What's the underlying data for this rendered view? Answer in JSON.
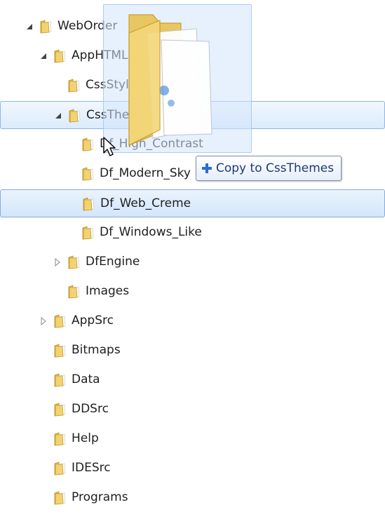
{
  "tree": {
    "items": [
      {
        "label": "WebOrder",
        "level": 0,
        "expander": "expanded",
        "state": "normal"
      },
      {
        "label": "AppHTML",
        "level": 1,
        "expander": "expanded",
        "state": "normal"
      },
      {
        "label": "CssStyle",
        "level": 2,
        "expander": "none",
        "state": "normal"
      },
      {
        "label": "CssThemes",
        "level": 2,
        "expander": "expanded",
        "state": "hover"
      },
      {
        "label": "Df_High_Contrast",
        "level": 3,
        "expander": "none",
        "state": "normal"
      },
      {
        "label": "Df_Modern_Sky",
        "level": 3,
        "expander": "none",
        "state": "normal"
      },
      {
        "label": "Df_Web_Creme",
        "level": 3,
        "expander": "none",
        "state": "drop"
      },
      {
        "label": "Df_Windows_Like",
        "level": 3,
        "expander": "none",
        "state": "normal"
      },
      {
        "label": "DfEngine",
        "level": 2,
        "expander": "collapsed",
        "state": "normal"
      },
      {
        "label": "Images",
        "level": 2,
        "expander": "none",
        "state": "normal"
      },
      {
        "label": "AppSrc",
        "level": 1,
        "expander": "collapsed",
        "state": "normal"
      },
      {
        "label": "Bitmaps",
        "level": 1,
        "expander": "none",
        "state": "normal"
      },
      {
        "label": "Data",
        "level": 1,
        "expander": "none",
        "state": "normal"
      },
      {
        "label": "DDSrc",
        "level": 1,
        "expander": "none",
        "state": "normal"
      },
      {
        "label": "Help",
        "level": 1,
        "expander": "none",
        "state": "normal"
      },
      {
        "label": "IDESrc",
        "level": 1,
        "expander": "none",
        "state": "normal"
      },
      {
        "label": "Programs",
        "level": 1,
        "expander": "none",
        "state": "normal"
      }
    ]
  },
  "drag": {
    "ghost_icon": "folder-icon",
    "cursor_icon": "arrow-cursor-icon",
    "tooltip_icon": "plus-icon",
    "tooltip_text": "Copy to CssThemes"
  },
  "colors": {
    "hover_border": "#8fb6e4",
    "drop_border": "#84acdd",
    "folder_fill": "#f0cf6a",
    "tooltip_text": "#1e3a74",
    "plus_color": "#2a6bd6"
  }
}
